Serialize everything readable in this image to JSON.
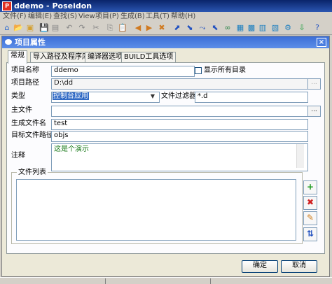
{
  "window": {
    "title": "ddemo - Poseidon",
    "app_icon": "P"
  },
  "menu": [
    {
      "label": "文件(F)"
    },
    {
      "label": "编辑(E)"
    },
    {
      "label": "查找(S)"
    },
    {
      "label": "View"
    },
    {
      "label": "项目(P)"
    },
    {
      "label": "生成(B)"
    },
    {
      "label": "工具(T)"
    },
    {
      "label": "帮助(H)"
    }
  ],
  "toolbar": [
    {
      "name": "home-icon",
      "glyph": "⌂",
      "color": "#2a6ad0"
    },
    {
      "name": "open-folder-icon",
      "glyph": "📂",
      "color": "#c89a2a"
    },
    {
      "name": "folder-icon",
      "glyph": "▣",
      "color": "#d4a030"
    },
    {
      "name": "save-icon",
      "glyph": "💾",
      "color": "#888"
    },
    {
      "name": "save-all-icon",
      "glyph": "▤",
      "color": "#888"
    },
    {
      "name": "undo-icon",
      "glyph": "↶",
      "color": "#888"
    },
    {
      "name": "redo-icon",
      "glyph": "↷",
      "color": "#888"
    },
    {
      "name": "cut-icon",
      "glyph": "✂",
      "color": "#888"
    },
    {
      "name": "copy-icon",
      "glyph": "⎘",
      "color": "#888"
    },
    {
      "name": "paste-icon",
      "glyph": "📋",
      "color": "#888"
    },
    {
      "name": "back-icon",
      "glyph": "◀",
      "color": "#d07a20"
    },
    {
      "name": "forward-icon",
      "glyph": "▶",
      "color": "#d07a20"
    },
    {
      "name": "stop-icon",
      "glyph": "✖",
      "color": "#d07a20"
    },
    {
      "name": "run-icon",
      "glyph": "⬈",
      "color": "#2050c0"
    },
    {
      "name": "step-into-icon",
      "glyph": "⬊",
      "color": "#2050c0"
    },
    {
      "name": "step-over-icon",
      "glyph": "⤳",
      "color": "#2050c0"
    },
    {
      "name": "step-out-icon",
      "glyph": "⬉",
      "color": "#2050c0"
    },
    {
      "name": "link-icon",
      "glyph": "∞",
      "color": "#208040"
    },
    {
      "name": "build-icon",
      "glyph": "▦",
      "color": "#2080c0"
    },
    {
      "name": "rebuild-icon",
      "glyph": "▩",
      "color": "#2080c0"
    },
    {
      "name": "compile-icon",
      "glyph": "▥",
      "color": "#2080c0"
    },
    {
      "name": "tool-icon",
      "glyph": "▧",
      "color": "#2080c0"
    },
    {
      "name": "settings-icon",
      "glyph": "⚙",
      "color": "#2080c0"
    },
    {
      "name": "download-icon",
      "glyph": "⇩",
      "color": "#20a040"
    },
    {
      "name": "help-icon",
      "glyph": "?",
      "color": "#2050c0"
    }
  ],
  "dialog": {
    "title": "项目属性",
    "close_glyph": "×",
    "tabs": [
      {
        "label": "常规"
      },
      {
        "label": "导入路径及程序库"
      },
      {
        "label": "编译器选项"
      },
      {
        "label": "BUILD工具选项"
      }
    ],
    "fields": {
      "project_name": {
        "label": "项目名称",
        "value": "ddemo"
      },
      "show_all_dirs": {
        "label": "显示所有目录",
        "checked": false
      },
      "project_path": {
        "label": "项目路径",
        "value": "D:\\dd"
      },
      "type": {
        "label": "类型",
        "value": "控制台应用"
      },
      "file_filter": {
        "label": "文件过滤器",
        "value": "*.d"
      },
      "main_file": {
        "label": "主文件",
        "value": ""
      },
      "output_name": {
        "label": "生成文件名",
        "value": "test"
      },
      "target_path": {
        "label": "目标文件路径",
        "value": "objs"
      },
      "comment": {
        "label": "注释",
        "value": "这是个演示"
      }
    },
    "browse_label": "...",
    "file_list_label": "文件列表",
    "side_buttons": [
      {
        "name": "add-file-button",
        "glyph": "+",
        "color": "#1a9a1a"
      },
      {
        "name": "remove-file-button",
        "glyph": "✖",
        "color": "#d02020"
      },
      {
        "name": "edit-file-button",
        "glyph": "✎",
        "color": "#d08020"
      },
      {
        "name": "sort-file-button",
        "glyph": "⇅",
        "color": "#2050c0"
      }
    ],
    "ok_label": "确定",
    "cancel_label": "取消"
  }
}
